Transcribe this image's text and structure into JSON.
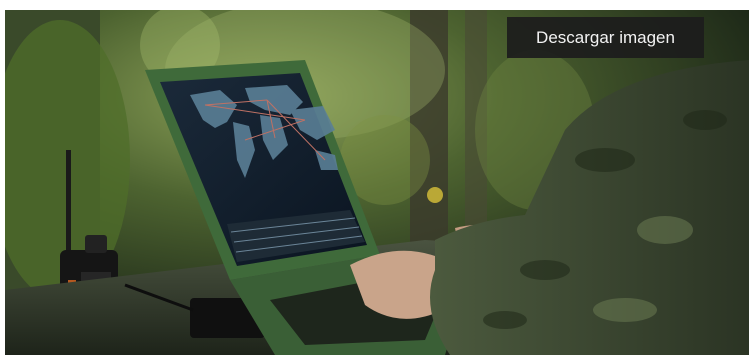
{
  "image": {
    "alt": "",
    "download_label": "Descargar imagen"
  },
  "colors": {
    "button_bg": "#1c1c1c",
    "button_text": "#f2f2f2"
  }
}
